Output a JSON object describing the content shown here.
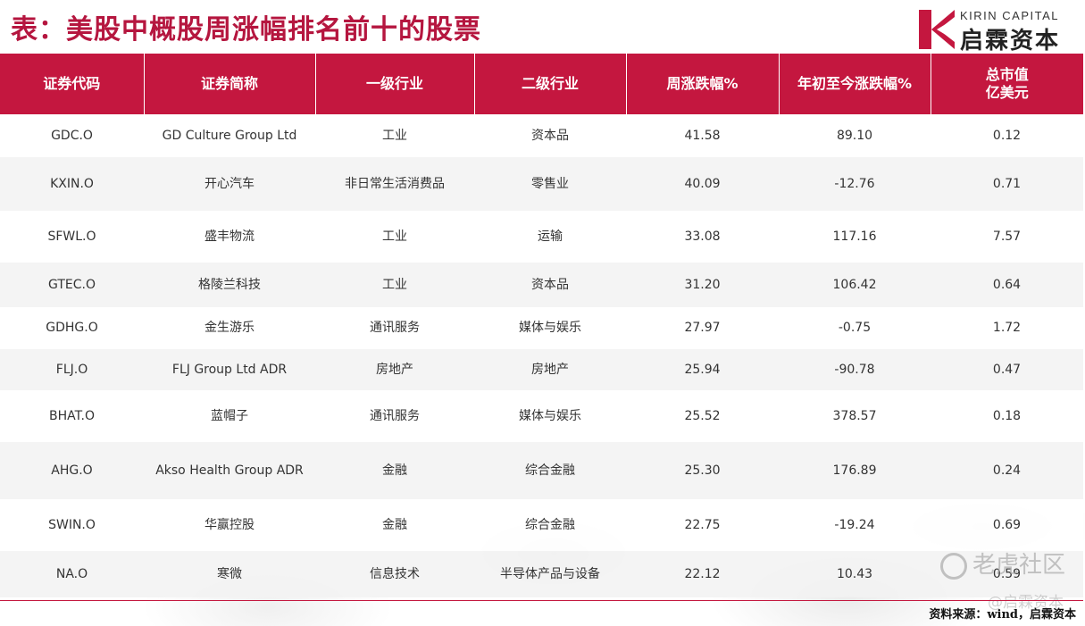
{
  "title": "表：美股中概股周涨幅排名前十的股票",
  "logo": {
    "en": "KIRIN CAPITAL",
    "cn": "启霖资本"
  },
  "colors": {
    "accent": "#c4173f",
    "title": "#b5163f"
  },
  "table": {
    "headers": [
      "证券代码",
      "证券简称",
      "一级行业",
      "二级行业",
      "周涨跌幅%",
      "年初至今涨跌幅%",
      "总市值\n亿美元"
    ],
    "rows": [
      [
        "GDC.O",
        "GD Culture Group Ltd",
        "工业",
        "资本品",
        "41.58",
        "89.10",
        "0.12"
      ],
      [
        "KXIN.O",
        "开心汽车",
        "非日常生活消费品",
        "零售业",
        "40.09",
        "-12.76",
        "0.71"
      ],
      [
        "SFWL.O",
        "盛丰物流",
        "工业",
        "运输",
        "33.08",
        "117.16",
        "7.57"
      ],
      [
        "GTEC.O",
        "格陵兰科技",
        "工业",
        "资本品",
        "31.20",
        "106.42",
        "0.64"
      ],
      [
        "GDHG.O",
        "金生游乐",
        "通讯服务",
        "媒体与娱乐",
        "27.97",
        "-0.75",
        "1.72"
      ],
      [
        "FLJ.O",
        "FLJ Group Ltd ADR",
        "房地产",
        "房地产",
        "25.94",
        "-90.78",
        "0.47"
      ],
      [
        "BHAT.O",
        "蓝帽子",
        "通讯服务",
        "媒体与娱乐",
        "25.52",
        "378.57",
        "0.18"
      ],
      [
        "AHG.O",
        "Akso Health Group ADR",
        "金融",
        "综合金融",
        "25.30",
        "176.89",
        "0.24"
      ],
      [
        "SWIN.O",
        "华赢控股",
        "金融",
        "综合金融",
        "22.75",
        "-19.24",
        "0.69"
      ],
      [
        "NA.O",
        "寒微",
        "信息技术",
        "半导体产品与设备",
        "22.12",
        "10.43",
        "0.59"
      ]
    ]
  },
  "source": "资料来源：wind，启霖资本",
  "watermark": {
    "main": "老虎社区",
    "sub": "@启霖资本"
  }
}
